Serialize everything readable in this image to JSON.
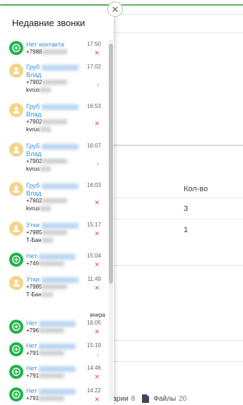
{
  "panel": {
    "title": "Недавние звонки",
    "date_separator": "вчера",
    "calls": [
      {
        "name": "Нет контакта",
        "name2": "",
        "phone": "+7988",
        "org": "",
        "time": "17:50",
        "status": "missed",
        "avatar": "green"
      },
      {
        "name": "Груб",
        "name2": "Влад",
        "phone": "+7902",
        "org": "kvrus",
        "time": "17:02",
        "status": "incoming",
        "avatar": "yellow"
      },
      {
        "name": "Груб",
        "name2": "Влад",
        "phone": "+7902",
        "org": "kvrus",
        "time": "16:53",
        "status": "missed",
        "avatar": "yellow"
      },
      {
        "name": "Груб",
        "name2": "Влад",
        "phone": "+7902",
        "org": "kvrus",
        "time": "16:07",
        "status": "incoming",
        "avatar": "yellow"
      },
      {
        "name": "Груб",
        "name2": "Влад",
        "phone": "+7902",
        "org": "kvrus",
        "time": "16:03",
        "status": "missed",
        "avatar": "yellow"
      },
      {
        "name": "Утки",
        "name2": "",
        "phone": "+7985",
        "org": "Т-Бан",
        "time": "15:17",
        "status": "missed",
        "avatar": "yellow"
      },
      {
        "name": "Нет",
        "name2": "",
        "phone": "+749",
        "org": "",
        "time": "15:04",
        "status": "missed",
        "avatar": "green"
      },
      {
        "name": "Утки",
        "name2": "",
        "phone": "+7985",
        "org": "Т-Бан",
        "time": "11:49",
        "status": "missed",
        "avatar": "yellow"
      },
      {
        "name": "Нет",
        "name2": "",
        "phone": "+796",
        "org": "",
        "time": "16:05",
        "status": "missed",
        "avatar": "green"
      },
      {
        "name": "Нет",
        "name2": "",
        "phone": "+791",
        "org": "",
        "time": "15:19",
        "status": "incoming",
        "avatar": "green"
      },
      {
        "name": "Нет",
        "name2": "",
        "phone": "+791",
        "org": "",
        "time": "14:46",
        "status": "missed",
        "avatar": "green"
      },
      {
        "name": "Нет",
        "name2": "",
        "phone": "+791",
        "org": "",
        "time": "14:22",
        "status": "missed",
        "avatar": "green"
      }
    ]
  },
  "background": {
    "column_header": "Кол-во",
    "row_values": [
      "3",
      "1"
    ],
    "bottom_tabs": [
      {
        "label": "тарии",
        "count": "8"
      },
      {
        "label": "Файлы",
        "count": "20"
      }
    ]
  },
  "icons": {
    "close": "close-icon",
    "add_contact": "plus-circle-icon",
    "contact": "person-icon",
    "missed": "x-icon",
    "incoming": "arrow-down-icon",
    "file": "file-icon"
  },
  "colors": {
    "green_avatar": "#21b34a",
    "yellow_avatar": "#f5d48a",
    "link": "#3a8fd8",
    "missed": "#e24a4a",
    "incoming": "#3bb55a"
  }
}
